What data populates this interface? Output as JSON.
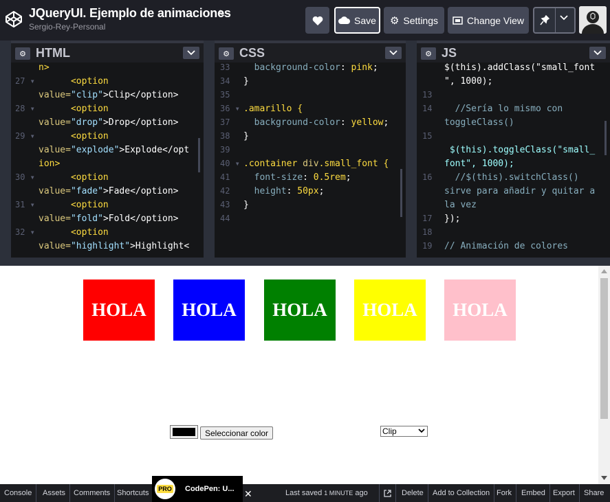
{
  "header": {
    "title": "JQueryUI. Ejemplo de animaciones",
    "author": "Sergio-Rey-Personal",
    "save_label": "Save",
    "settings_label": "Settings",
    "view_label": "Change View"
  },
  "panes": {
    "html": {
      "name": "HTML"
    },
    "css": {
      "name": "CSS"
    },
    "js": {
      "name": "JS"
    }
  },
  "html_code": {
    "l0": "n>",
    "n27": "27",
    "l27a": "      <option",
    "l27b_pre": "value=",
    "l27b_str": "\"clip\"",
    "l27b_post": ">Clip</option>",
    "n28": "28",
    "l28a": "      <option",
    "l28b_pre": "value=",
    "l28b_str": "\"drop\"",
    "l28b_post": ">Drop</option>",
    "n29": "29",
    "l29a": "      <option",
    "l29b_pre": "value=",
    "l29b_str": "\"explode\"",
    "l29b_post": ">Explode</opt",
    "l29c": "ion>",
    "n30": "30",
    "l30a": "      <option",
    "l30b_pre": "value=",
    "l30b_str": "\"fade\"",
    "l30b_post": ">Fade</option>",
    "n31": "31",
    "l31a": "      <option",
    "l31b_pre": "value=",
    "l31b_str": "\"fold\"",
    "l31b_post": ">Fold</option>",
    "n32": "32",
    "l32a": "      <option",
    "l32b_pre": "value=",
    "l32b_str": "\"highlight\"",
    "l32b_post": ">Highlight<"
  },
  "css_code": {
    "n33": "33",
    "l33_prop": "  background-color",
    "l33_val": "pink",
    "n34": "34",
    "l34": "}",
    "n35": "35",
    "n36": "36",
    "l36": ".amarillo {",
    "n37": "37",
    "l37_prop": "  background-color",
    "l37_val": "yellow",
    "n38": "38",
    "l38": "}",
    "n39": "39",
    "n40": "40",
    "l40a": ".container ",
    "l40b": "div",
    "l40c": ".small_font {",
    "n41": "41",
    "l41_prop": "  font-size",
    "l41_val": "0.5rem",
    "n42": "42",
    "l42_prop": "  height",
    "l42_val": "50px",
    "n43": "43",
    "l43": "}",
    "n44": "44"
  },
  "js_code": {
    "l0": "$(this).addClass(\"small_font",
    "l0b": "\", 1000);",
    "n13": "13",
    "n14": "14",
    "l14": "  //Sería lo mismo con",
    "l14b": "toggleClass()",
    "n15": "15",
    "l15b": " $(this).toggleClass(\"small_",
    "l15c": "font\", 1000);",
    "n16": "16",
    "l16": "  //$(this).switchClass()",
    "l16b": "sirve para añadir y quitar a",
    "l16c": "la vez",
    "n17": "17",
    "l17": "});",
    "n18": "18",
    "n19": "19",
    "l19": "// Animación de colores"
  },
  "preview": {
    "boxes": [
      {
        "text": "HOLA",
        "color": "#ff0000"
      },
      {
        "text": "HOLA",
        "color": "#0000ff"
      },
      {
        "text": "HOLA",
        "color": "#008000"
      },
      {
        "text": "HOLA",
        "color": "#ffff00"
      },
      {
        "text": "HOLA",
        "color": "#ffc0cb"
      }
    ],
    "color_button": "Seleccionar color",
    "select_value": "Clip"
  },
  "footer": {
    "console": "Console",
    "assets": "Assets",
    "comments": "Comments",
    "shortcuts": "Shortcuts",
    "promo_badge": "PRO",
    "promo_text": "CodePen: U...",
    "last_saved": "Last saved",
    "last_saved_time": "1 MINUTE",
    "last_saved_suffix": "ago",
    "delete": "Delete",
    "add_collection": "Add to Collection",
    "fork": "Fork",
    "embed": "Embed",
    "export": "Export",
    "share": "Share"
  }
}
